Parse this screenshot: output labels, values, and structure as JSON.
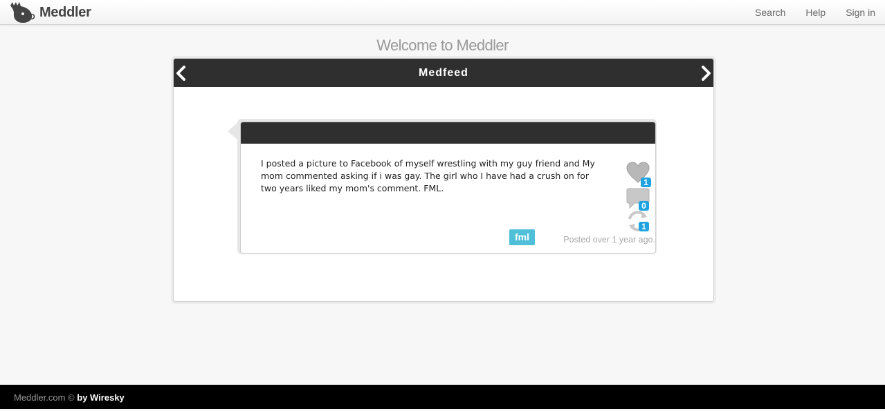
{
  "header": {
    "brand": "Meddler",
    "nav": [
      "Search",
      "Help",
      "Sign in"
    ]
  },
  "page_title": "Welcome to Meddler",
  "feed": {
    "title": "Medfeed",
    "post": {
      "text": "I posted a picture to Facebook of myself wrestling with my guy friend and My mom commented asking if i was gay. The girl who I have had a crush on for two years liked my mom's comment. FML.",
      "likes": "1",
      "comments": "0",
      "reshares": "1",
      "tag": "fml",
      "posted": "Posted over 1 year ago."
    }
  },
  "footer": {
    "site": "Meddler.com ©",
    "by": "by Wiresky"
  },
  "colors": {
    "header_dark": "#2f2f2f",
    "count_badge": "#1fa3e0",
    "tag": "#4fc0d8"
  }
}
